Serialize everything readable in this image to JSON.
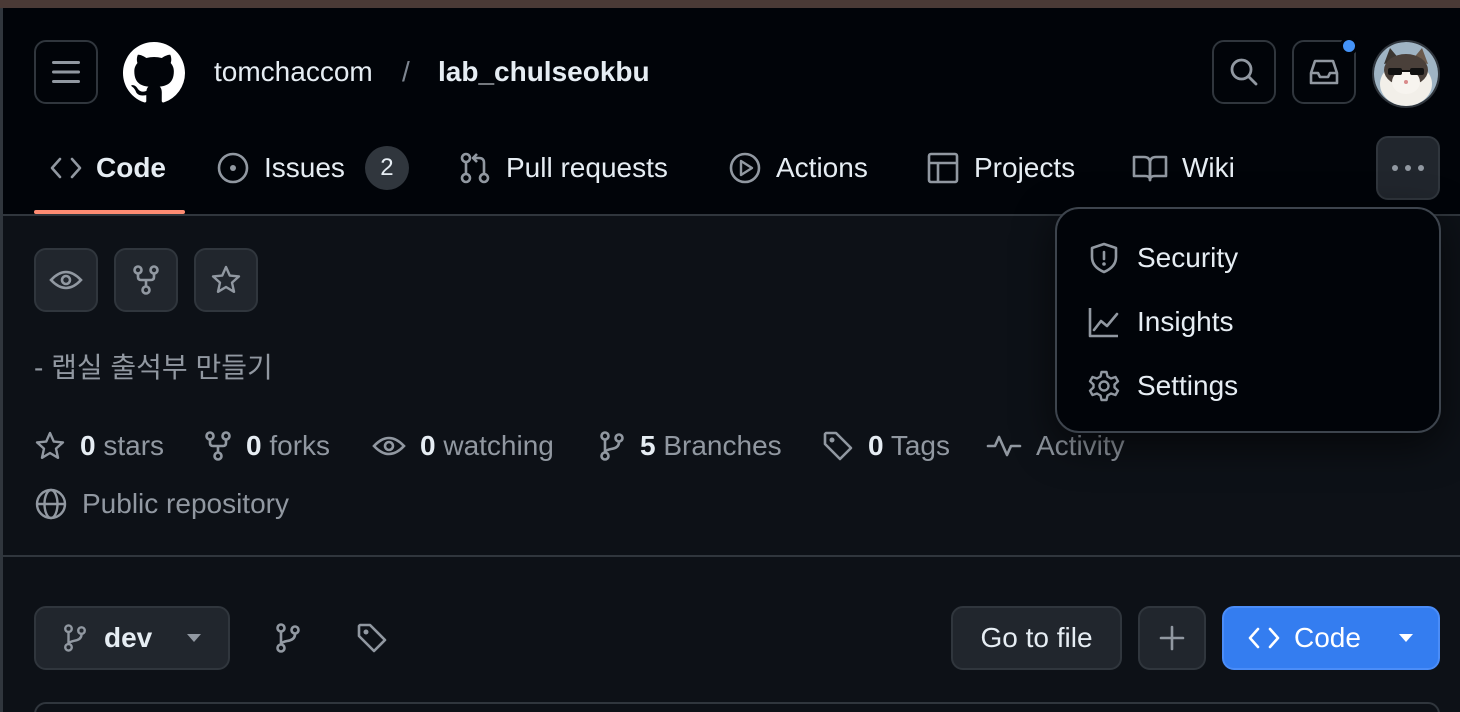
{
  "header": {
    "owner": "tomchaccom",
    "separator": "/",
    "repo": "lab_chulseokbu"
  },
  "tabs": [
    {
      "label": "Code",
      "icon": "code-icon",
      "active": true
    },
    {
      "label": "Issues",
      "icon": "issue-opened-icon",
      "count": "2"
    },
    {
      "label": "Pull requests",
      "icon": "git-pull-request-icon"
    },
    {
      "label": "Actions",
      "icon": "play-icon"
    },
    {
      "label": "Projects",
      "icon": "table-icon"
    },
    {
      "label": "Wiki",
      "icon": "book-icon"
    }
  ],
  "more_menu": {
    "items": [
      {
        "label": "Security",
        "icon": "shield-icon"
      },
      {
        "label": "Insights",
        "icon": "graph-icon"
      },
      {
        "label": "Settings",
        "icon": "gear-icon"
      }
    ]
  },
  "repo_info": {
    "description": "- 랩실 출석부 만들기",
    "stats": {
      "stars_count": "0",
      "stars_label": "stars",
      "forks_count": "0",
      "forks_label": "forks",
      "watching_count": "0",
      "watching_label": "watching",
      "branches_count": "5",
      "branches_label": "Branches",
      "tags_count": "0",
      "tags_label": "Tags",
      "activity_label": "Activity"
    },
    "visibility": "Public repository"
  },
  "toolbar": {
    "branch": "dev",
    "goto_file": "Go to file",
    "code_button": "Code"
  },
  "colors": {
    "background": "#0d1117",
    "header_bg": "#010409",
    "border": "#30363d",
    "accent_underline": "#fd8c73",
    "primary_button": "#347df0",
    "notification_dot": "#4493f8"
  }
}
